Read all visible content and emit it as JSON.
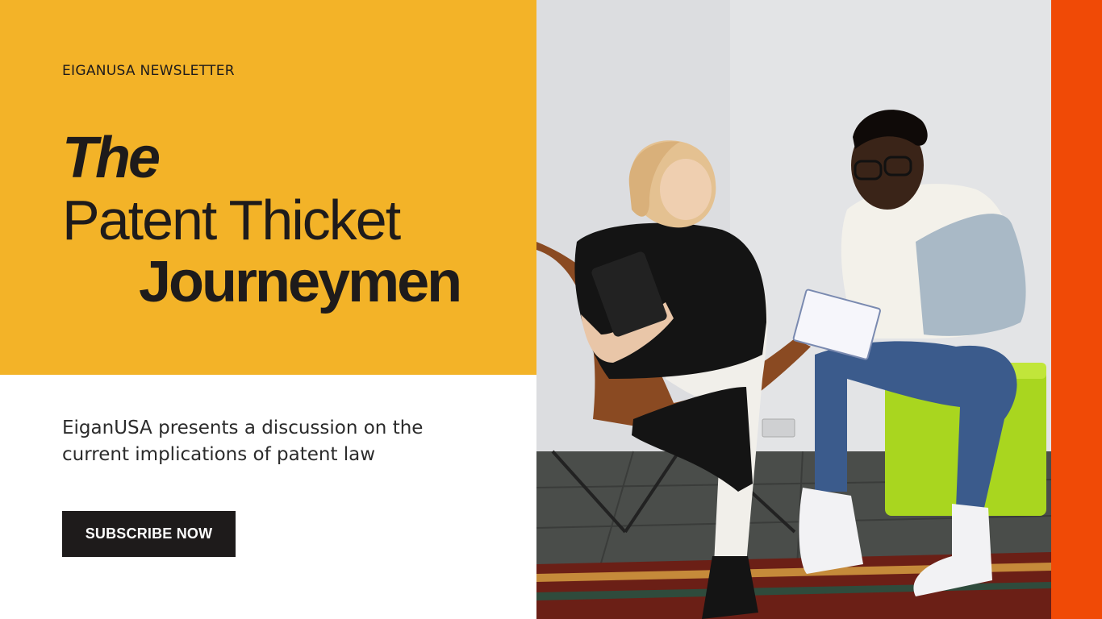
{
  "newsletter": {
    "eyebrow": "EIGANUSA NEWSLETTER",
    "title_line1": "The",
    "title_line2": "Patent Thicket",
    "title_line3": "Journeymen",
    "description": "EiganUSA presents a discussion on the current implications of patent law",
    "cta_label": "SUBSCRIBE NOW"
  },
  "colors": {
    "panel_yellow": "#F3B328",
    "accent_orange": "#F04A06",
    "text_dark": "#1e1b1b",
    "button_bg": "#1e1b1b"
  }
}
